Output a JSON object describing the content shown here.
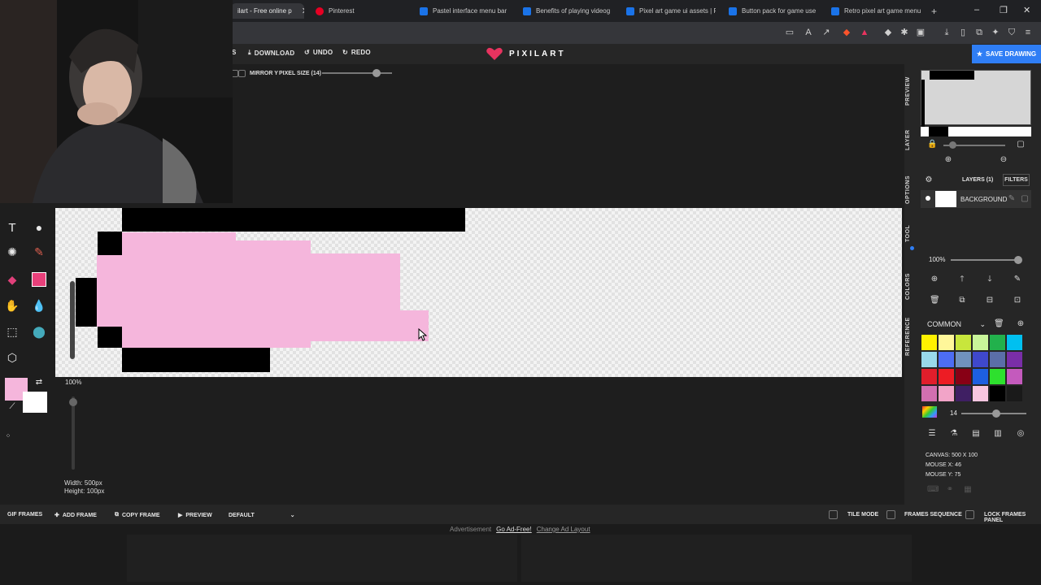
{
  "browser": {
    "tabs": [
      {
        "label": "ilart - Free online p",
        "active": true,
        "color": "#2d6cdf"
      },
      {
        "label": "Pinterest",
        "color": "#e60023"
      },
      {
        "label": "Pastel interface menu bar",
        "color": "#1a73e8"
      },
      {
        "label": "Benefits of playing videog",
        "color": "#1a73e8"
      },
      {
        "label": "Pixel art game ui assets | F",
        "color": "#1a73e8"
      },
      {
        "label": "Button pack for game use",
        "color": "#1a73e8"
      },
      {
        "label": "Retro pixel art game menu",
        "color": "#1a73e8"
      }
    ],
    "new_tab": "+",
    "tab_close": "✕"
  },
  "header": {
    "download": "DOWNLOAD",
    "undo": "UNDO",
    "redo": "REDO",
    "partial_left": "S",
    "logo": "PIXILART",
    "save": "SAVE DRAWING"
  },
  "sub_toolbar": {
    "mirror_y": "MIRROR Y",
    "pixel_size": "PIXEL SIZE (14)",
    "pixel_size_value": 14,
    "pixel_size_fraction": 0.78
  },
  "canvas_panel": {
    "zoom": "100%",
    "width": "Width: 500px",
    "height": "Height: 100px"
  },
  "right_panel": {
    "tabs": [
      "PREVIEW",
      "LAYER",
      "OPTIONS",
      "TOOL",
      "COLORS",
      "REFERENCE"
    ],
    "layers_title": "LAYERS (1)",
    "filters": "FILTERS",
    "layer_name": "BACKGROUND",
    "opacity": "100%",
    "palette_name": "COMMON",
    "brush_size": "14",
    "canvas_info": "CANVAS: 500 X 100",
    "mouse_x": "MOUSE X: 46",
    "mouse_y": "MOUSE Y: 75",
    "palette": [
      "#fff200",
      "#fff79a",
      "#c8e63c",
      "#c9f59a",
      "#22b14c",
      "#00c0f0",
      "#99d9ea",
      "#4d6df3",
      "#7092be",
      "#3f48cc",
      "#5b6ea8",
      "#7a2ea8",
      "#e01e2b",
      "#ed1c24",
      "#880015",
      "#1d5fe0",
      "#2ee02e",
      "#c45abd",
      "#d26fb0",
      "#f2a4c8",
      "#3f1f63",
      "#f8c6e0",
      "#000000",
      "#1a1a1a"
    ],
    "current_color": "#f5b6dc"
  },
  "frame_bar": {
    "gif_frames": "GIF FRAMES",
    "add_frame": "ADD FRAME",
    "copy_frame": "COPY FRAME",
    "preview": "PREVIEW",
    "default": "DEFAULT",
    "tile_mode": "TILE MODE",
    "frames_sequence": "FRAMES SEQUENCE",
    "lock_frames": "LOCK FRAMES PANEL"
  },
  "ads": {
    "label": "Advertisement",
    "go_ad_free": "Go Ad-Free!",
    "change_layout": "Change Ad Layout"
  },
  "colors": {
    "accent": "#2f7ef5",
    "pink": "#f5b6dc",
    "heart": "#e8335f"
  }
}
